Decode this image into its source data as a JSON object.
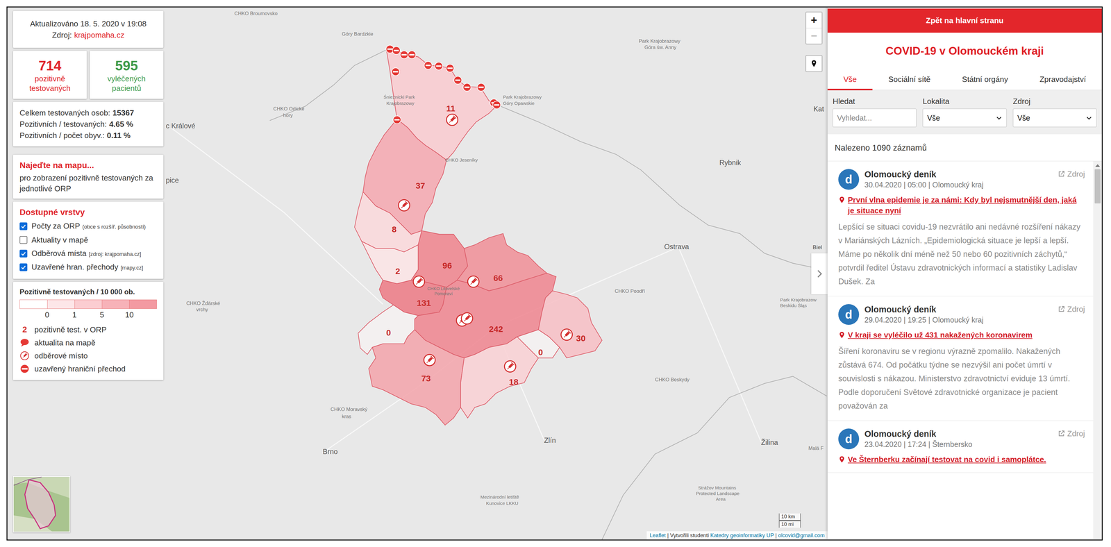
{
  "header": {
    "updated": "Aktualizováno 18. 5. 2020 v 19:08",
    "source_label": "Zdroj:",
    "source_link": "krajpomaha.cz"
  },
  "stats": [
    {
      "value": "714",
      "label": "pozitivně testovaných",
      "color": "#e0262c"
    },
    {
      "value": "595",
      "label": "vyléčených pacientů",
      "color": "#3f9b4b"
    }
  ],
  "ratios": [
    {
      "label": "Celkem testovaných osob:",
      "value": "15367"
    },
    {
      "label": "Pozitivních / testovaných:",
      "value": "4.65 %"
    },
    {
      "label": "Pozitivních / počet obyv.:",
      "value": "0.11 %"
    }
  ],
  "hint": {
    "title": "Najeďte na mapu...",
    "text": "pro zobrazení pozitivně testovaných za jednotlivé ORP"
  },
  "layers": {
    "title": "Dostupné vrstvy",
    "items": [
      {
        "kind": "counts",
        "label": "Počty za ORP",
        "note": "(obce s rozšíř. působností)",
        "checked": true
      },
      {
        "kind": "news",
        "label": "Aktuality v mapě",
        "note": "",
        "checked": false
      },
      {
        "kind": "sites",
        "label": "Odběrová místa",
        "note": "[zdroj: krajpomaha.cz]",
        "checked": true
      },
      {
        "kind": "crossings",
        "label": "Uzavřené hran. přechody",
        "note": "[mapy.cz]",
        "checked": true
      }
    ]
  },
  "legend": {
    "title": "Pozitivně testovaných / 10 000 ob.",
    "scale": [
      {
        "color": "#ffffff"
      },
      {
        "color": "#fde6e8"
      },
      {
        "color": "#fbcdd1"
      },
      {
        "color": "#f7b2b8"
      },
      {
        "color": "#f39aa2"
      }
    ],
    "ticks": [
      "0",
      "1",
      "5",
      "10"
    ],
    "items": [
      {
        "kind": "count",
        "symbol": "2",
        "label": "pozitivně test. v ORP"
      },
      {
        "kind": "news",
        "symbol": "",
        "label": "aktualita na mapě"
      },
      {
        "kind": "site",
        "symbol": "",
        "label": "odběrové místo"
      },
      {
        "kind": "crossing",
        "symbol": "",
        "label": "uzavřený hraniční přechod"
      }
    ]
  },
  "map": {
    "regions": [
      {
        "count": "11",
        "color": "#f8ccd0"
      },
      {
        "count": "37",
        "color": "#f4abb2"
      },
      {
        "count": "8",
        "color": "#fad9dc"
      },
      {
        "count": "2",
        "color": "#fbe4e6"
      },
      {
        "count": "96",
        "color": "#ee8891"
      },
      {
        "count": "66",
        "color": "#f0939b"
      },
      {
        "count": "131",
        "color": "#ec7f89"
      },
      {
        "count": "242",
        "color": "#ee8a93"
      },
      {
        "count": "0",
        "color": "#f4f1f1"
      },
      {
        "count": "73",
        "color": "#f3a7ae"
      },
      {
        "count": "18",
        "color": "#f8d1d5"
      },
      {
        "count": "0",
        "color": "#f4f1f1"
      },
      {
        "count": "30",
        "color": "#f6c1c6"
      }
    ],
    "labels": [
      "CHKO Broumovsko",
      "Góry Bardzkie",
      "Park Krajobrazowy",
      "Góra św. Anny",
      "Śnieżnicki Park",
      "Krajobrazowy",
      "Park Krajobrazowy",
      "Góry Opawskie",
      "CHKO Orlické",
      "hory",
      "c Králové",
      "pice",
      "CHKO Jeseníky",
      "Kat",
      "Rybnik",
      "Ostrava",
      "Biel",
      "CHKO Poodří",
      "Park Krajobrazow",
      "Beskidu Śląs",
      "CHKO Žďárské",
      "vrchy",
      "CHKO Litovelské",
      "Pomoraví",
      "CHKO Moravský",
      "kras",
      "Brno",
      "Zlín",
      "CHKO Beskydy",
      "Žilina",
      "Strážov Mountains",
      "Protected Landscape",
      "Area",
      "Mezinárodní letiště",
      "Kunovice LKKU",
      "Malá F"
    ],
    "zoom": [
      "+",
      "−"
    ],
    "scale": [
      "10 km",
      "10 mi"
    ],
    "attribution": [
      {
        "text": "Leaflet",
        "link": true
      },
      {
        "text": " | Vytvořili studenti ",
        "link": false
      },
      {
        "text": "Katedry geoinformatiky UP",
        "link": true
      },
      {
        "text": " | ",
        "link": false
      },
      {
        "text": "olcovid@gmail.com",
        "link": true
      }
    ]
  },
  "panel": {
    "back": "Zpět na hlavní stranu",
    "title": "COVID-19 v Olomouckém kraji",
    "tabs": [
      {
        "label": "Vše",
        "selected": true
      },
      {
        "label": "Sociální sítě",
        "selected": false
      },
      {
        "label": "Státní orgány",
        "selected": false
      },
      {
        "label": "Zpravodajství",
        "selected": false
      }
    ],
    "filters": [
      {
        "kind": "input",
        "label": "Hledat",
        "value": "Vyhledat..."
      },
      {
        "kind": "select",
        "label": "Lokalita",
        "value": "Vše"
      },
      {
        "kind": "select",
        "label": "Zdroj",
        "value": "Vše"
      }
    ],
    "count": "Nalezeno 1090 záznamů",
    "articles": [
      {
        "logo": "d",
        "source": "Olomoucký deník",
        "link": "Zdroj",
        "meta": "30.04.2020 | 05:00 | Olomoucký kraj",
        "title": "První vlna epidemie je za námi: Kdy byl nejsmutnější den, jaká je situace nyní",
        "excerpt": "Lepšící se situaci covidu-19 nezvrátilo ani nedávné rozšíření nákazy v Mariánských Lázních. „Epidemiologická situace je lepší a lepší. Máme po několik dní méně než 50 nebo 60 pozitivních záchytů,“ potvrdil ředitel Ústavu zdravotnických informací a statistiky Ladislav Dušek. Za"
      },
      {
        "logo": "d",
        "source": "Olomoucký deník",
        "link": "Zdroj",
        "meta": "29.04.2020 | 19:25 | Olomoucký kraj",
        "title": "V kraji se vyléčilo už 431 nakažených koronavirem",
        "excerpt": "Šíření koronaviru se v regionu výrazně zpomalilo. Nakažených zůstává 674. Od počátku týdne se nezvýšil ani počet úmrtí v souvislosti s nákazou. Ministerstvo zdravotnictví eviduje 13 úmrtí. Podle doporučení Světové zdravotnické organizace je pacient považován za"
      },
      {
        "logo": "d",
        "source": "Olomoucký deník",
        "link": "Zdroj",
        "meta": "23.04.2020 | 17:24 | Šternbersko",
        "title": "Ve Šternberku začínají testovat na covid i samoplátce.",
        "excerpt": ""
      }
    ],
    "scrollbar": {
      "level": 0.09
    }
  }
}
